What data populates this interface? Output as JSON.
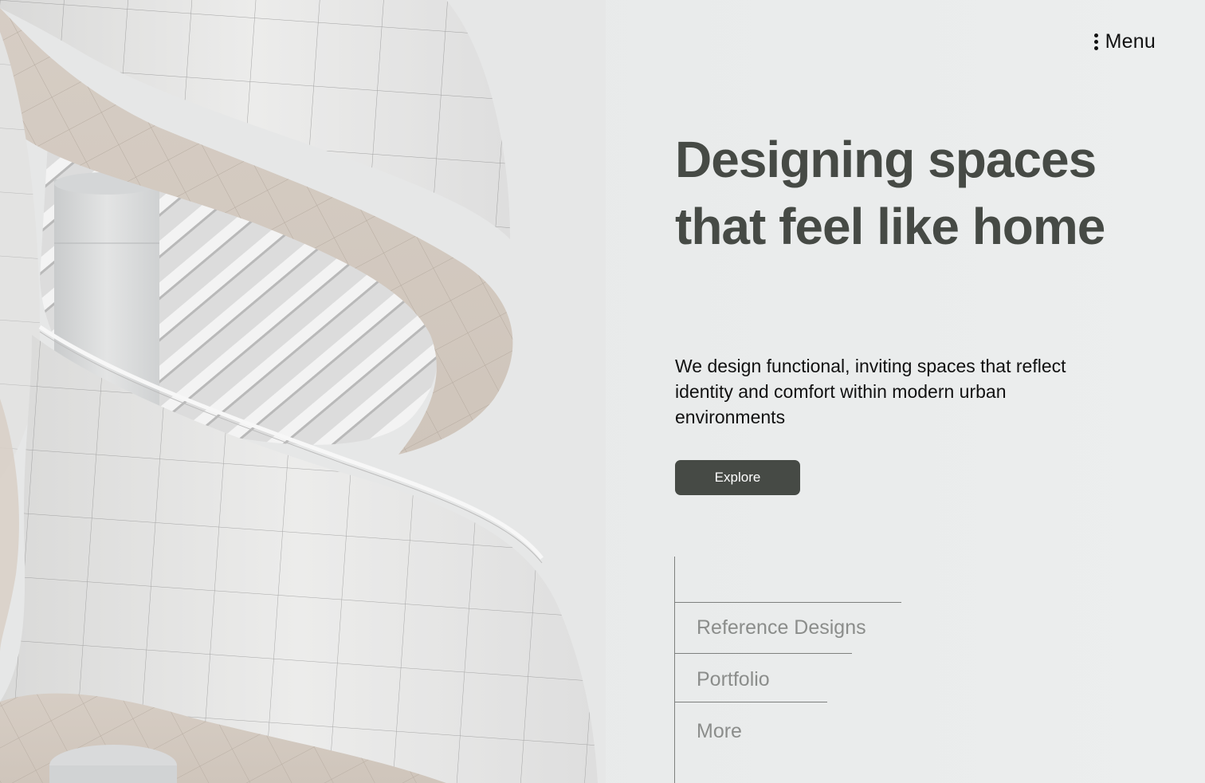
{
  "header": {
    "menu_label": "Menu"
  },
  "hero": {
    "headline": "Designing spaces that feel like home",
    "subtext": "We design functional, inviting spaces that reflect identity and comfort within modern urban environments",
    "cta_label": "Explore"
  },
  "side_nav": {
    "items": [
      {
        "label": "Reference Designs"
      },
      {
        "label": "Portfolio"
      },
      {
        "label": "More"
      }
    ]
  },
  "colors": {
    "background": "#e8eaea",
    "headline": "#464a45",
    "button": "#464a45",
    "nav_text": "#8b8d8b",
    "body_text": "#111111"
  },
  "icons": {
    "menu": "vertical-dots-icon"
  }
}
